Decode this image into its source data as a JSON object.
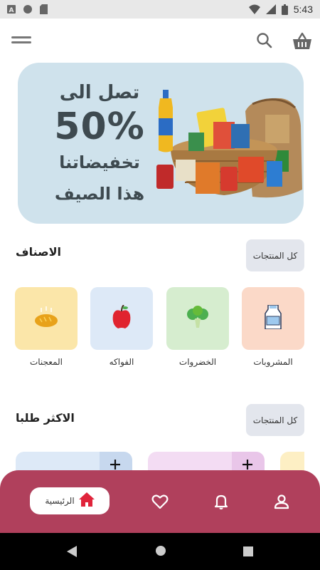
{
  "status_bar": {
    "time": "5:43",
    "left_icons": [
      "notification-a-icon",
      "circle-icon",
      "sd-card-icon"
    ],
    "right_icons": [
      "wifi-icon",
      "signal-icon",
      "battery-icon"
    ]
  },
  "header": {
    "icons": [
      "menu-icon",
      "search-icon",
      "basket-icon"
    ]
  },
  "banner": {
    "line1": "تصل الى",
    "percent": "50%",
    "line3": "تخفيضاتنا",
    "line4": "هذا الصيف",
    "background": "#cfe2ec"
  },
  "categories_section": {
    "title": "الاصناف",
    "all_button": "كل المنتجات",
    "items": [
      {
        "label": "المشروبات",
        "icon": "milk-carton-icon",
        "bg": "#fbd9c8"
      },
      {
        "label": "الخضروات",
        "icon": "broccoli-icon",
        "bg": "#d6edcf"
      },
      {
        "label": "الفواكه",
        "icon": "apple-icon",
        "bg": "#dde9f7"
      },
      {
        "label": "المعجنات",
        "icon": "bread-icon",
        "bg": "#fbe6a9"
      }
    ]
  },
  "popular_section": {
    "title": "الاكثر طلبا",
    "all_button": "كل المنتجات",
    "card_colors": [
      "#dde9f7",
      "#f3dcf3",
      "#fdefc4"
    ]
  },
  "bottom_nav": {
    "home_label": "الرئيسية",
    "icons": [
      "home-icon",
      "heart-icon",
      "bell-icon",
      "user-icon"
    ],
    "background": "#b0405c"
  },
  "colors": {
    "accent": "#b0405c",
    "home_icon": "#e0243b"
  }
}
